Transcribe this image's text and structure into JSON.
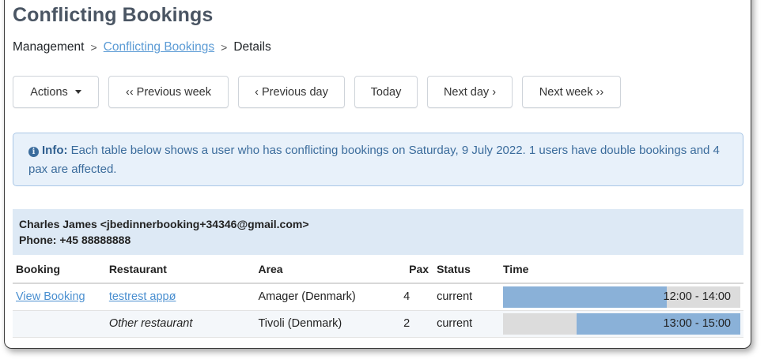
{
  "page": {
    "title": "Conflicting Bookings"
  },
  "breadcrumb": {
    "root": "Management",
    "current_link": "Conflicting Bookings",
    "last": "Details"
  },
  "toolbar": {
    "actions": "Actions",
    "previous_week": "‹‹ Previous week",
    "previous_day": "‹ Previous day",
    "today": "Today",
    "next_day": "Next day ›",
    "next_week": "Next week ››"
  },
  "info": {
    "label": "Info:",
    "line": "Each table below shows a user who has conflicting bookings on Saturday, 9 July 2022. 1 users have double bookings and 4 pax are affected."
  },
  "user": {
    "name_email": "Charles James <jbedinnerbooking+34346@gmail.com>",
    "phone": "Phone: +45 88888888"
  },
  "table": {
    "headers": {
      "booking": "Booking",
      "restaurant": "Restaurant",
      "area": "Area",
      "pax": "Pax",
      "status": "Status",
      "time": "Time"
    },
    "rows": [
      {
        "booking": "View Booking",
        "restaurant": "testrest appø",
        "area": "Amager (Denmark)",
        "pax": "4",
        "status": "current",
        "time": "12:00 - 14:00",
        "bar_start": 0.0,
        "bar_end": 0.69
      },
      {
        "booking": "",
        "restaurant": "Other restaurant",
        "area": "Tivoli (Denmark)",
        "pax": "2",
        "status": "current",
        "time": "13:00 - 15:00",
        "bar_start": 0.31,
        "bar_end": 1.0
      }
    ]
  },
  "colors": {
    "info_bg": "#e8f1fa",
    "info_text": "#3b6c9c",
    "bar_fill": "#8ab1d8",
    "bar_track": "#dcdcdc",
    "link": "#4a8fd0"
  }
}
